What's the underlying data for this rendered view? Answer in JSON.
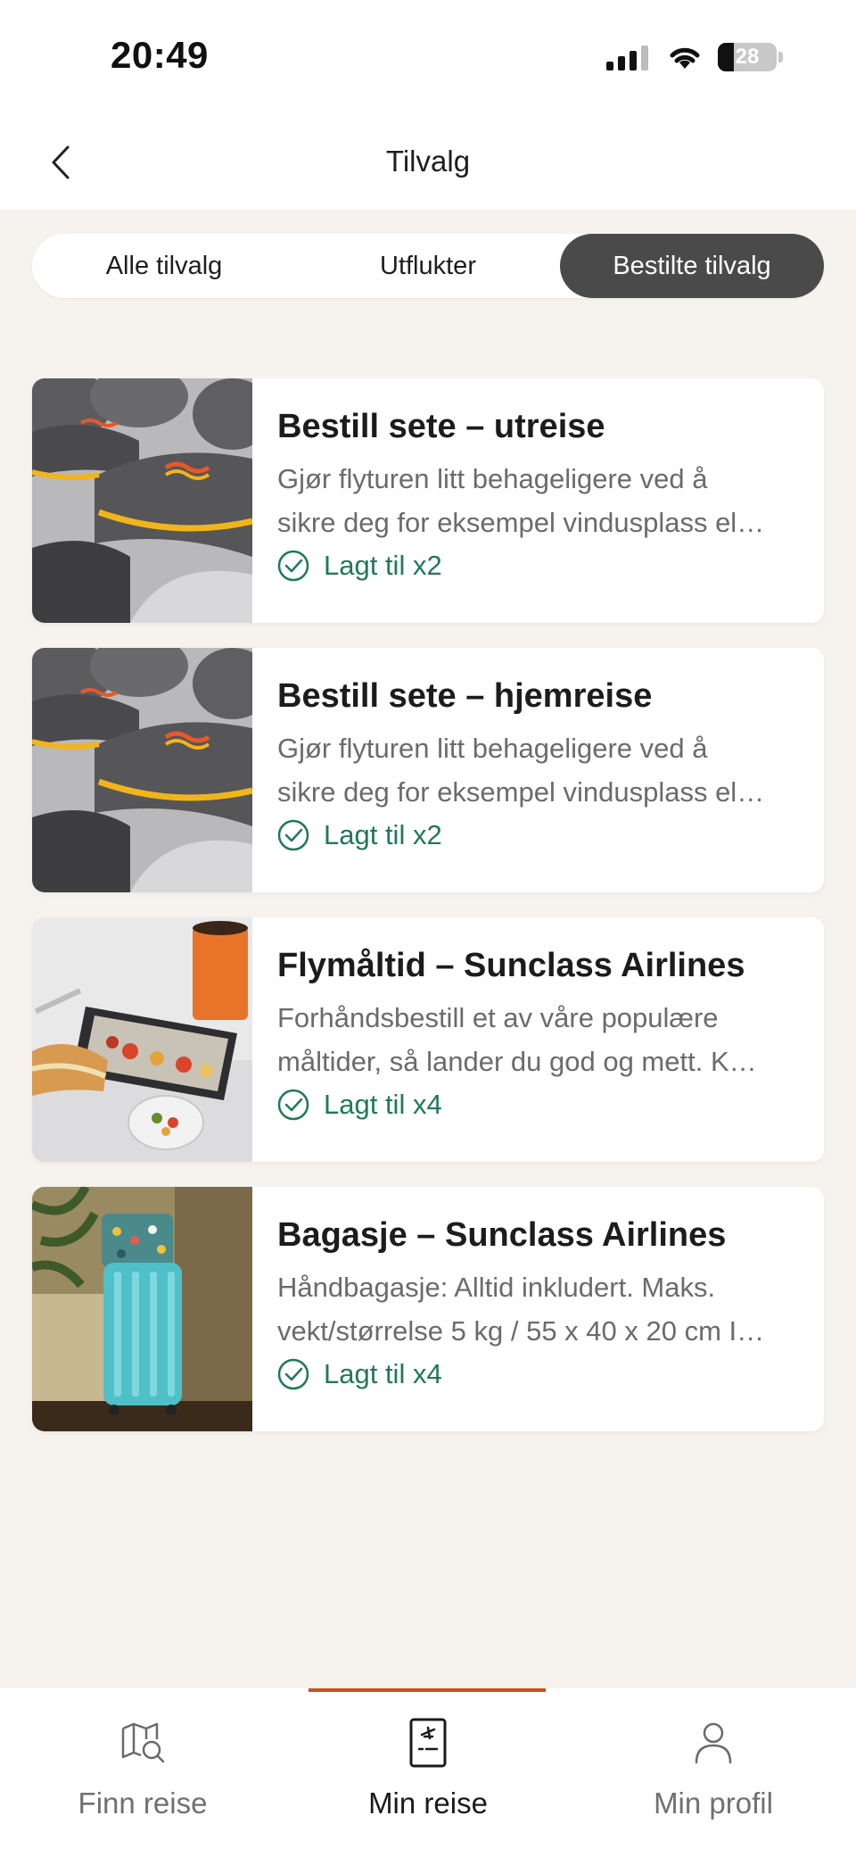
{
  "status_bar": {
    "time": "20:49",
    "battery": "28"
  },
  "header": {
    "title": "Tilvalg",
    "back_icon": "chevron-left-icon"
  },
  "tabs": [
    {
      "label": "Alle tilvalg",
      "active": false
    },
    {
      "label": "Utflukter",
      "active": false
    },
    {
      "label": "Bestilte tilvalg",
      "active": true
    }
  ],
  "cards": [
    {
      "title": "Bestill sete – utreise",
      "desc_line1": "Gjør flyturen litt behageligere ved å",
      "desc_line2": "sikre deg for eksempel vindusplass el…",
      "added": "Lagt til x2",
      "image": "airplane-seats-image"
    },
    {
      "title": "Bestill sete – hjemreise",
      "desc_line1": "Gjør flyturen litt behageligere ved å",
      "desc_line2": "sikre deg for eksempel vindusplass el…",
      "added": "Lagt til x2",
      "image": "airplane-seats-image"
    },
    {
      "title": "Flymåltid – Sunclass Airlines",
      "desc_line1": "Forhåndsbestill et av våre populære",
      "desc_line2": "måltider, så lander du god og mett. K…",
      "added": "Lagt til x4",
      "image": "meal-tray-image"
    },
    {
      "title": "Bagasje – Sunclass Airlines",
      "desc_line1": "Håndbagasje: Alltid inkludert. Maks.",
      "desc_line2": "vekt/størrelse 5 kg / 55 x 40 x 20 cm I…",
      "added": "Lagt til x4",
      "image": "suitcase-image"
    }
  ],
  "bottom_nav": [
    {
      "label": "Finn reise",
      "icon": "map-search-icon",
      "active": false
    },
    {
      "label": "Min reise",
      "icon": "boarding-pass-icon",
      "active": true
    },
    {
      "label": "Min profil",
      "icon": "person-icon",
      "active": false
    }
  ],
  "colors": {
    "accent": "#c4531e",
    "success": "#1f7a55",
    "tab_active": "#4a4a4a",
    "background": "#f6f3ee"
  }
}
